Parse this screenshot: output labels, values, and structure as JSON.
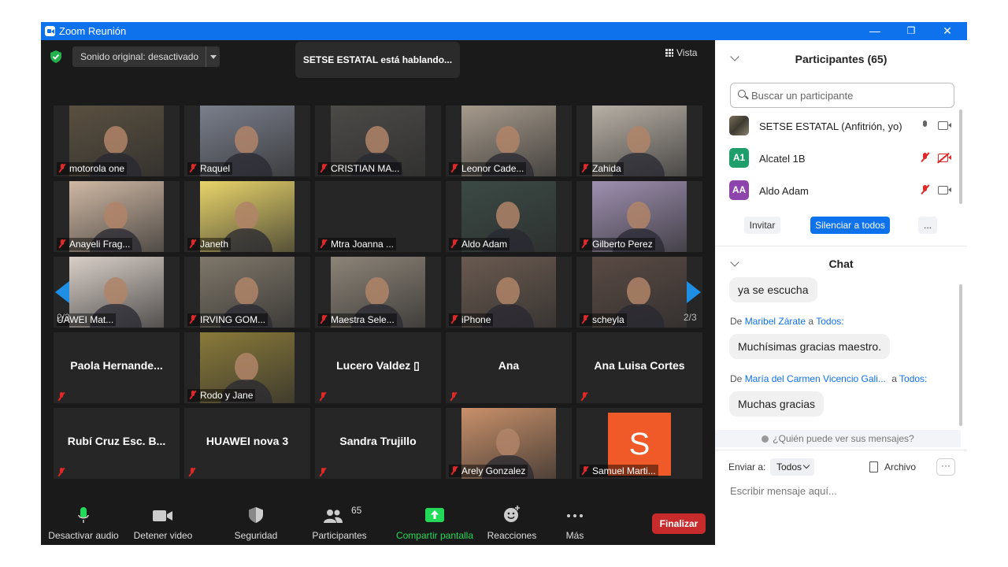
{
  "window": {
    "title": "Zoom Reunión",
    "minimize": "—",
    "restore": "❐",
    "close": "✕"
  },
  "meeting": {
    "audio_dropdown": "Sonido original: desactivado",
    "speaking": "SETSE ESTATAL está hablando...",
    "view_label": "Vista",
    "page_indicator": "2/3",
    "tiles": [
      {
        "name": "motorola one",
        "bg": "#5a5040",
        "mic_muted": true
      },
      {
        "name": "Raquel",
        "bg": "#7a7f8c",
        "mic_muted": true
      },
      {
        "name": "CRISTIAN MA...",
        "bg": "#4b4a47",
        "mic_muted": true
      },
      {
        "name": "Leonor Cade...",
        "bg": "#a69a8c",
        "mic_muted": true
      },
      {
        "name": "Zahida",
        "bg": "#b8b0a6",
        "mic_muted": true
      },
      {
        "name": "Anayeli Frag...",
        "bg": "#cfb8a4",
        "mic_muted": true
      },
      {
        "name": "Janeth",
        "bg": "#e8d46a",
        "mic_muted": true
      },
      {
        "name": "Mtra Joanna ...",
        "bg": "",
        "mic_muted": true
      },
      {
        "name": "Aldo Adam",
        "bg": "#3b4a45",
        "mic_muted": true
      },
      {
        "name": "Gilberto Perez",
        "bg": "#9e8fb0",
        "mic_muted": true
      },
      {
        "name": "UAWEI Mat...",
        "bg": "#d9cfc8",
        "mic_muted": false
      },
      {
        "name": "IRVING GOM...",
        "bg": "#7f776a",
        "mic_muted": true
      },
      {
        "name": "Maestra Sele...",
        "bg": "#8d8478",
        "mic_muted": true
      },
      {
        "name": "iPhone",
        "bg": "#6a5a50",
        "mic_muted": true
      },
      {
        "name": "scheyla",
        "bg": "#5a4a44",
        "mic_muted": true
      },
      {
        "name": "Paola  Hernande...",
        "bg": "",
        "mic_muted": true,
        "label_only": true
      },
      {
        "name": "Rodo y Jane",
        "bg": "#8a7a3a",
        "mic_muted": true
      },
      {
        "name": "Lucero  Valdez ▯",
        "bg": "",
        "mic_muted": true,
        "label_only": true
      },
      {
        "name": "Ana",
        "bg": "",
        "mic_muted": true,
        "label_only": true
      },
      {
        "name": "Ana Luisa Cortes",
        "bg": "",
        "mic_muted": true,
        "label_only": true
      },
      {
        "name": "Rubí  Cruz Esc. B...",
        "bg": "",
        "mic_muted": true,
        "label_only": true
      },
      {
        "name": "HUAWEI nova 3",
        "bg": "",
        "mic_muted": true,
        "label_only": true
      },
      {
        "name": "Sandra Trujillo",
        "bg": "",
        "mic_muted": true,
        "label_only": true
      },
      {
        "name": "Arely Gonzalez",
        "bg": "#c8906a",
        "mic_muted": true
      },
      {
        "name": "Samuel Marti...",
        "bg": "",
        "mic_muted": true,
        "avatar_letter": "S",
        "avatar_color": "#f05a28"
      }
    ]
  },
  "toolbar": {
    "mute_audio": "Desactivar audio",
    "stop_video": "Detener video",
    "security": "Seguridad",
    "participants": "Participantes",
    "participants_count": "65",
    "share_screen": "Compartir pantalla",
    "reactions": "Reacciones",
    "more": "Más",
    "end": "Finalizar"
  },
  "participants_panel": {
    "title": "Participantes (65)",
    "search_placeholder": "Buscar un participante",
    "rows": [
      {
        "name": "SETSE ESTATAL (Anfitrión, yo)",
        "avatar": "",
        "color": "#5a5a4a"
      },
      {
        "name": "Alcatel 1B",
        "avatar": "A1",
        "color": "#1e9e6a"
      },
      {
        "name": "Aldo Adam",
        "avatar": "AA",
        "color": "#8e44ad"
      }
    ],
    "invite": "Invitar",
    "mute_all": "Silenciar a todos",
    "more": "..."
  },
  "chat_panel": {
    "title": "Chat",
    "messages": [
      {
        "text": "ya se escucha"
      },
      {
        "from_prefix": "De",
        "from": "Maribel Zárate",
        "to_prefix": "a",
        "to": "Todos:",
        "text": "Muchísimas gracias maestro."
      },
      {
        "from_prefix": "De",
        "from": "María del Carmen Vicencio Gali...",
        "to_prefix": "a",
        "to": "Todos:",
        "text": "Muchas gracias"
      }
    ],
    "who_can_see": "¿Quién puede ver sus mensajes?",
    "send_to_label": "Enviar a:",
    "send_to_value": "Todos",
    "file_label": "Archivo",
    "more": "···",
    "input_placeholder": "Escribir mensaje aquí..."
  },
  "colors": {
    "accent": "#0e72ed",
    "end_red": "#c72b2b",
    "muted_red": "#e02828",
    "share_green": "#23d959"
  }
}
